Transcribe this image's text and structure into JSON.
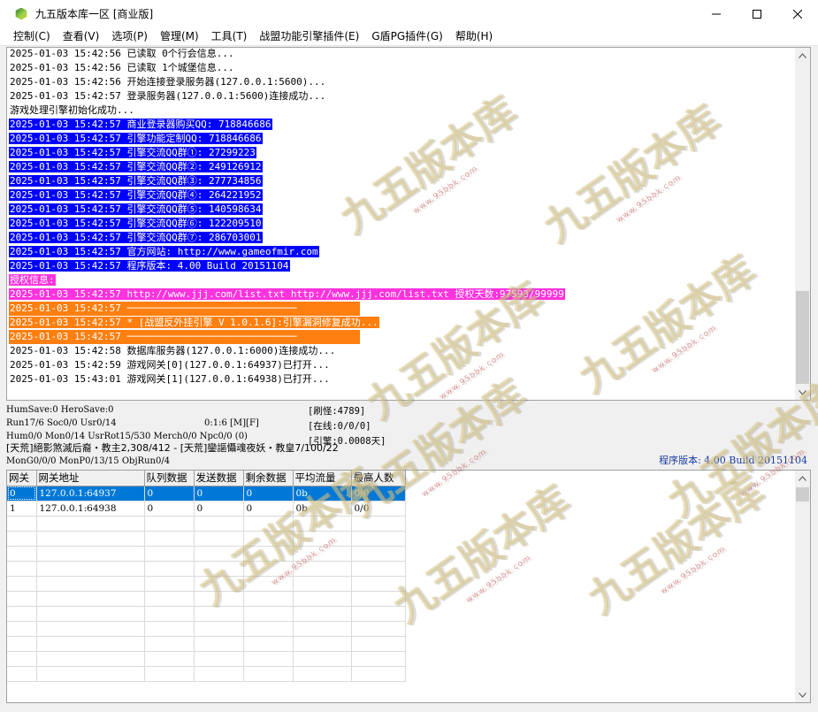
{
  "window": {
    "title": "九五版本库一区 [商业版]",
    "controls": {
      "minimize": "─",
      "maximize": "☐",
      "close": "✕"
    }
  },
  "menu": [
    "控制(C)",
    "查看(V)",
    "选项(P)",
    "管理(M)",
    "工具(T)",
    "战盟功能引擎插件(E)",
    "G盾PG插件(G)",
    "帮助(H)"
  ],
  "log": [
    {
      "text": "2025-01-03 15:42:56 已读取 0个行会信息...",
      "hl": ""
    },
    {
      "text": "2025-01-03 15:42:56 已读取 1个城堡信息...",
      "hl": ""
    },
    {
      "text": "2025-01-03 15:42:56 开始连接登录服务器(127.0.0.1:5600)...",
      "hl": ""
    },
    {
      "text": "2025-01-03 15:42:57 登录服务器(127.0.0.1:5600)连接成功...",
      "hl": ""
    },
    {
      "text": "游戏处理引擎初始化成功...",
      "hl": ""
    },
    {
      "text": "2025-01-03 15:42:57 商业登录器购买QQ: 718846686",
      "hl": "blue"
    },
    {
      "text": "2025-01-03 15:42:57 引擎功能定制QQ: 718846686",
      "hl": "blue"
    },
    {
      "text": "2025-01-03 15:42:57 引擎交流QQ群①: 27299223",
      "hl": "blue"
    },
    {
      "text": "2025-01-03 15:42:57 引擎交流QQ群②: 249126912",
      "hl": "blue"
    },
    {
      "text": "2025-01-03 15:42:57 引擎交流QQ群③: 277734856",
      "hl": "blue"
    },
    {
      "text": "2025-01-03 15:42:57 引擎交流QQ群④: 264221952",
      "hl": "blue"
    },
    {
      "text": "2025-01-03 15:42:57 引擎交流QQ群⑤: 140598634",
      "hl": "blue"
    },
    {
      "text": "2025-01-03 15:42:57 引擎交流QQ群⑥: 122209510",
      "hl": "blue"
    },
    {
      "text": "2025-01-03 15:42:57 引擎交流QQ群⑦: 286703001",
      "hl": "blue"
    },
    {
      "text": "2025-01-03 15:42:57 官方网站: http://www.gameofmir.com",
      "hl": "blue"
    },
    {
      "text": "2025-01-03 15:42:57 程序版本: 4.00 Build 20151104",
      "hl": "blue"
    },
    {
      "text": "授权信息:",
      "hl": "magenta"
    },
    {
      "text": "2025-01-03 15:42:57 http://www.jjj.com/list.txt http://www.jjj.com/list.txt 授权天数:97593/99999",
      "hl": "magenta"
    },
    {
      "text": "2025-01-03 15:42:57 ─────────────────────────────",
      "hl": "orange-wide"
    },
    {
      "text": "2025-01-03 15:42:57 * [战盟反外挂引擎 V 1.0.1.6]:引擎漏洞修复成功...",
      "hl": "orange"
    },
    {
      "text": "2025-01-03 15:42:57 ─────────────────────────────",
      "hl": "orange-wide"
    },
    {
      "text": "2025-01-03 15:42:58 数据库服务器(127.0.0.1:6000)连接成功...",
      "hl": ""
    },
    {
      "text": "2025-01-03 15:42:59 游戏网关[0](127.0.0.1:64937)已打开...",
      "hl": ""
    },
    {
      "text": "2025-01-03 15:43:01 游戏网关[1](127.0.0.1:64938)已打开...",
      "hl": ""
    }
  ],
  "status": {
    "line1": "HumSave:0 HeroSave:0",
    "line2": "Run17/6 Soc0/0 Usr0/14",
    "line2b": "0:1:6 [M][F]",
    "line3": "Hum0/0 Mon0/14 UsrRot15/530 Merch0/0 Npc0/0 (0)",
    "line4": "[天荒]絕影煞滅后裔・教主2,308/412 - [天荒]鑾謳懾魂夜妖・教皇7/100/22",
    "line5": "MonG0/0/0 MonP0/13/15 ObjRun0/4",
    "box1": "[刷怪:4789]",
    "box2": "[在线:0/0/0]",
    "box3": "[引擎:0.0008天]",
    "version": "程序版本: 4.00 Build 20151104"
  },
  "gate_table": {
    "columns": [
      "网关",
      "网关地址",
      "队列数据",
      "发送数据",
      "剩余数据",
      "平均流量",
      "最高人数"
    ],
    "rows": [
      [
        "0",
        "127.0.0.1:64937",
        "0",
        "0",
        "0",
        "0b",
        "0/0"
      ],
      [
        "1",
        "127.0.0.1:64938",
        "0",
        "0",
        "0",
        "0b",
        "0/0"
      ]
    ],
    "selected_row": 0
  },
  "watermark": {
    "text": "九五版本库",
    "sub": "www.95bbk.com"
  },
  "colors": {
    "hl_blue": "#0000ff",
    "hl_magenta": "#ff33dd",
    "hl_orange": "#ff7f10",
    "selection": "#0078d7",
    "version_text": "#1a3b9e"
  }
}
